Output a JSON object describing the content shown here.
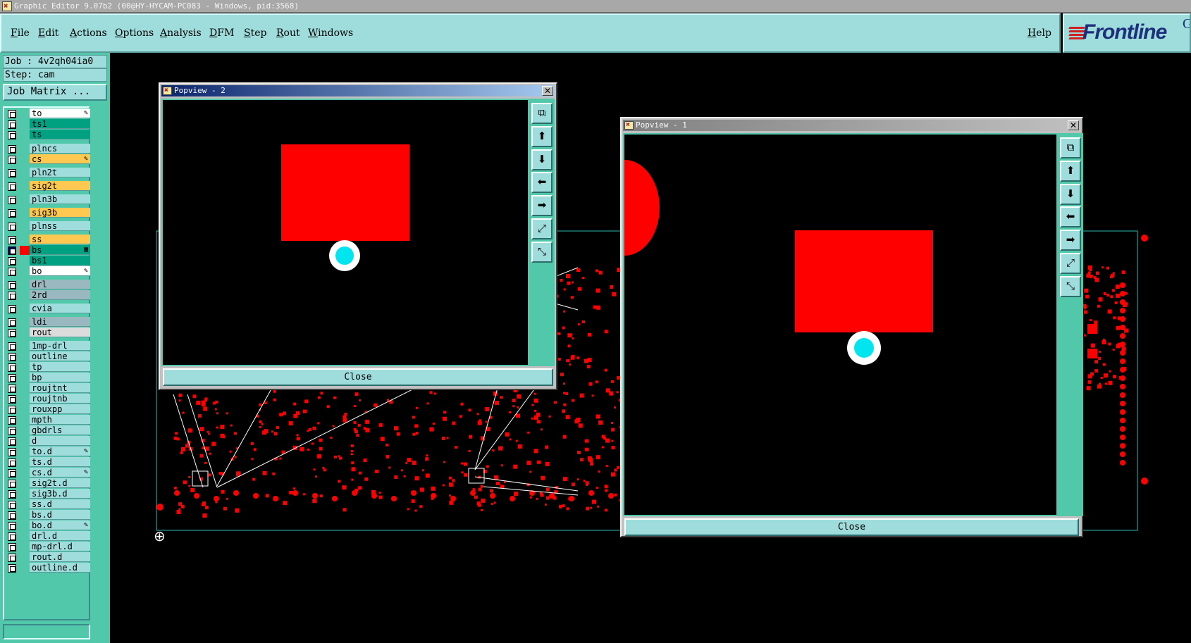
{
  "window": {
    "title": "Graphic Editor 9.07b2 (00@HY-HYCAM-PC083 - Windows, pid:3568)"
  },
  "menu": {
    "items": [
      "File",
      "Edit",
      "Actions",
      "Options",
      "Analysis",
      "DFM",
      "Step",
      "Rout",
      "Windows"
    ],
    "help": "Help"
  },
  "logo": {
    "text": "Frontline",
    "extra": "G"
  },
  "job": {
    "job_line": "Job : 4v2qh04ia0",
    "step_line": "Step: cam",
    "matrix_button": "Job Matrix ..."
  },
  "layers": [
    {
      "name": "to",
      "color": "#ffffff",
      "mark": "edit"
    },
    {
      "name": "ts1",
      "color": "#00a082"
    },
    {
      "name": "ts",
      "color": "#00a082"
    },
    {
      "name": "plncs",
      "color": "#9fdcdc"
    },
    {
      "name": "cs",
      "color": "#ffc850",
      "mark": "edit"
    },
    {
      "name": "pln2t",
      "color": "#9fdcdc"
    },
    {
      "name": "sig2t",
      "color": "#ffc850"
    },
    {
      "name": "pln3b",
      "color": "#9fdcdc"
    },
    {
      "name": "sig3b",
      "color": "#ffc850"
    },
    {
      "name": "plnss",
      "color": "#9fdcdc"
    },
    {
      "name": "ss",
      "color": "#ffc850"
    },
    {
      "name": "bs",
      "color": "#00a082",
      "mark": "work",
      "selected": true
    },
    {
      "name": "bs1",
      "color": "#00a082"
    },
    {
      "name": "bo",
      "color": "#ffffff",
      "mark": "edit"
    },
    {
      "name": "drl",
      "color": "#9ab8c0"
    },
    {
      "name": "2rd",
      "color": "#9ab8c0"
    },
    {
      "name": "cvia",
      "color": "#9fdcdc"
    },
    {
      "name": "ldi",
      "color": "#9ab8c0"
    },
    {
      "name": "rout",
      "color": "#dcdcdc"
    },
    {
      "name": "1mp-drl",
      "color": "#9fdcdc"
    },
    {
      "name": "outline",
      "color": "#9fdcdc"
    },
    {
      "name": "tp",
      "color": "#9fdcdc"
    },
    {
      "name": "bp",
      "color": "#9fdcdc"
    },
    {
      "name": "roujtnt",
      "color": "#9fdcdc"
    },
    {
      "name": "roujtnb",
      "color": "#9fdcdc"
    },
    {
      "name": "rouxpp",
      "color": "#9fdcdc"
    },
    {
      "name": "mpth",
      "color": "#9fdcdc"
    },
    {
      "name": "gbdrls",
      "color": "#9fdcdc"
    },
    {
      "name": "d",
      "color": "#9fdcdc"
    },
    {
      "name": "to.d",
      "color": "#9fdcdc",
      "mark": "edit"
    },
    {
      "name": "ts.d",
      "color": "#9fdcdc"
    },
    {
      "name": "cs.d",
      "color": "#9fdcdc",
      "mark": "edit"
    },
    {
      "name": "sig2t.d",
      "color": "#9fdcdc"
    },
    {
      "name": "sig3b.d",
      "color": "#9fdcdc"
    },
    {
      "name": "ss.d",
      "color": "#9fdcdc"
    },
    {
      "name": "bs.d",
      "color": "#9fdcdc"
    },
    {
      "name": "bo.d",
      "color": "#9fdcdc",
      "mark": "edit"
    },
    {
      "name": "drl.d",
      "color": "#9fdcdc"
    },
    {
      "name": "mp-drl.d",
      "color": "#9fdcdc"
    },
    {
      "name": "rout.d",
      "color": "#9fdcdc"
    },
    {
      "name": "outline.d",
      "color": "#9fdcdc"
    }
  ],
  "popview2": {
    "title": "Popview - 2",
    "close": "Close"
  },
  "popview1": {
    "title": "Popview - 1",
    "close": "Close"
  },
  "toolbar_icons": [
    "zoom-home-icon",
    "pan-up-icon",
    "pan-down-icon",
    "pan-left-icon",
    "pan-right-icon",
    "zoom-in-icon",
    "zoom-out-icon"
  ],
  "colors": {
    "feature_red": "#ff0000",
    "pad_cyan": "#00e5ee",
    "panel_teal": "#52c8ab",
    "menu_cyan": "#9fdcdc"
  }
}
